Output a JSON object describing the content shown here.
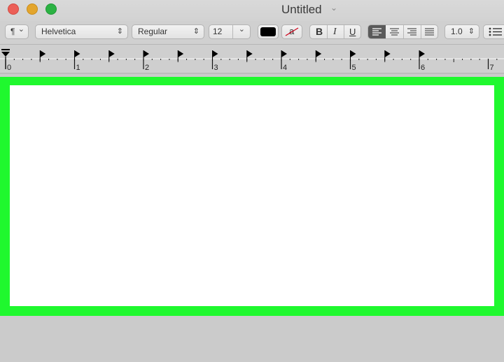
{
  "window": {
    "title": "Untitled",
    "title_chevron_icon": "chevron-down-icon"
  },
  "toolbar": {
    "paragraph_style_icon": "¶",
    "paragraph_chevron": "⌄",
    "font_family": "Helvetica",
    "font_style": "Regular",
    "font_size": "12",
    "size_chevron": "⌄",
    "stepper_glyph": "⌃⌄",
    "text_color": "#000000",
    "highlight_glyph": "a",
    "bold_label": "B",
    "italic_label": "I",
    "underline_label": "U",
    "alignment_selected": "left",
    "line_spacing": "1.0",
    "list_icon": "list-bullets-icon"
  },
  "ruler": {
    "labels": [
      "0",
      "1",
      "2",
      "3",
      "4",
      "5",
      "6",
      "7"
    ],
    "unit": "inches"
  },
  "colors": {
    "highlight_frame": "#1ff82e",
    "page": "#ffffff",
    "window_bg": "#cbcbcb"
  }
}
